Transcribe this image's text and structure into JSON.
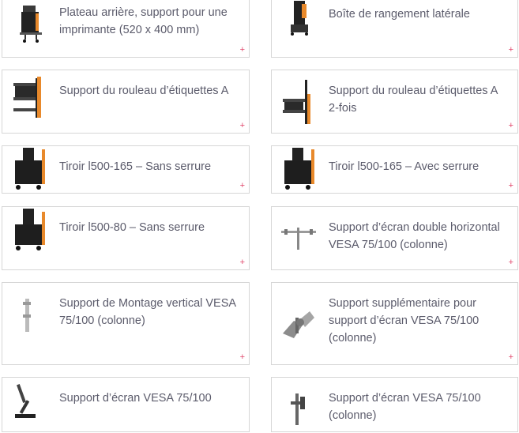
{
  "products": [
    {
      "title": "Plateau arrière, support pour une imprimante (520 x 400 mm)",
      "thumb": "cart-printer-icon"
    },
    {
      "title": "Boîte de rangement latérale",
      "thumb": "cart-side-box-icon"
    },
    {
      "title": "Support du rouleau d’étiquettes A",
      "thumb": "label-roll-holder-icon"
    },
    {
      "title": "Support du rouleau d’étiquettes A 2-fois",
      "thumb": "label-roll-holder-double-icon"
    },
    {
      "title": "Tiroir l500-165 – Sans serrure",
      "thumb": "drawer-cart-icon"
    },
    {
      "title": "Tiroir l500-165 – Avec serrure",
      "thumb": "drawer-cart-lock-icon"
    },
    {
      "title": "Tiroir l500-80 – Sans serrure",
      "thumb": "drawer-cart-small-icon"
    },
    {
      "title": "Support d’écran double horizontal VESA 75/100 (colonne)",
      "thumb": "dual-monitor-arm-icon"
    },
    {
      "title": "Support de Montage vertical VESA 75/100 (colonne)",
      "thumb": "vertical-mount-icon"
    },
    {
      "title": "Support supplémentaire pour support d’écran VESA 75/100 (colonne)",
      "thumb": "extra-monitor-bracket-icon"
    },
    {
      "title": "Support d’écran VESA 75/100",
      "thumb": "desk-monitor-arm-icon"
    },
    {
      "title": "Support d’écran VESA 75/100 (colonne)",
      "thumb": "column-monitor-arm-icon"
    }
  ],
  "add_symbol": "+",
  "colors": {
    "accent_plus": "#e0466a",
    "title_text": "#5b5b6b",
    "card_border": "#d6d6d6"
  }
}
